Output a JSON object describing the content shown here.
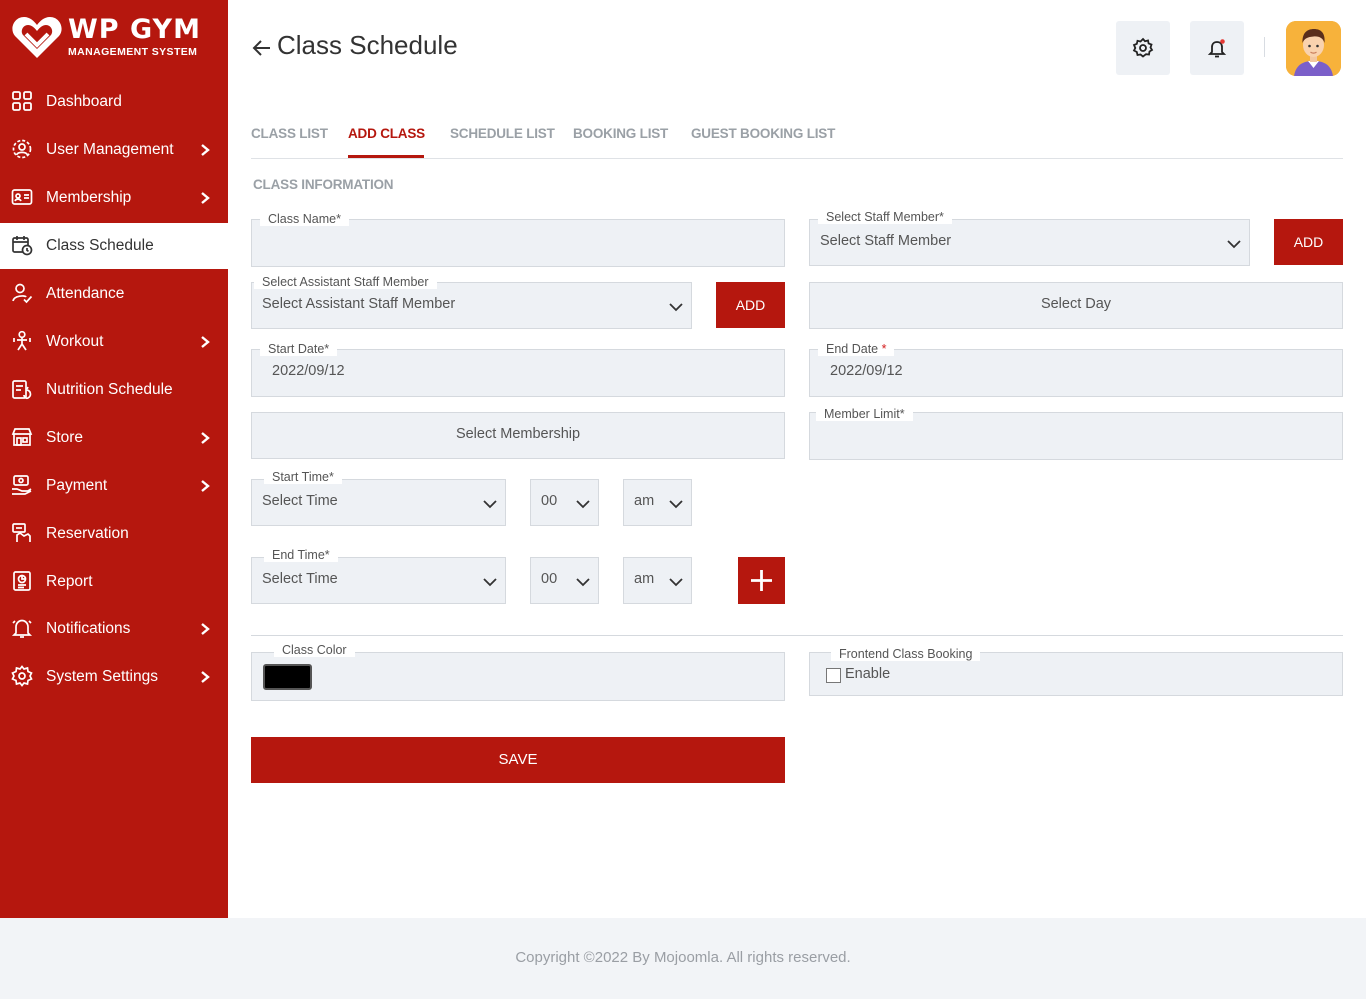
{
  "brand": {
    "name": "WP GYM",
    "subtitle": "MANAGEMENT SYSTEM"
  },
  "sidebar": {
    "items": [
      {
        "label": "Dashboard",
        "icon": "dashboard-icon",
        "has_submenu": false,
        "active": false
      },
      {
        "label": "User Management",
        "icon": "user-management-icon",
        "has_submenu": true,
        "active": false
      },
      {
        "label": "Membership",
        "icon": "membership-icon",
        "has_submenu": true,
        "active": false
      },
      {
        "label": "Class Schedule",
        "icon": "class-schedule-icon",
        "has_submenu": false,
        "active": true
      },
      {
        "label": "Attendance",
        "icon": "attendance-icon",
        "has_submenu": false,
        "active": false
      },
      {
        "label": "Workout",
        "icon": "workout-icon",
        "has_submenu": true,
        "active": false
      },
      {
        "label": "Nutrition Schedule",
        "icon": "nutrition-icon",
        "has_submenu": false,
        "active": false
      },
      {
        "label": "Store",
        "icon": "store-icon",
        "has_submenu": true,
        "active": false
      },
      {
        "label": "Payment",
        "icon": "payment-icon",
        "has_submenu": true,
        "active": false
      },
      {
        "label": "Reservation",
        "icon": "reservation-icon",
        "has_submenu": false,
        "active": false
      },
      {
        "label": "Report",
        "icon": "report-icon",
        "has_submenu": false,
        "active": false
      },
      {
        "label": "Notifications",
        "icon": "notifications-icon",
        "has_submenu": true,
        "active": false
      },
      {
        "label": "System Settings",
        "icon": "system-settings-icon",
        "has_submenu": true,
        "active": false
      }
    ]
  },
  "header": {
    "title": "Class Schedule"
  },
  "tabs": [
    {
      "label": "CLASS LIST",
      "active": false
    },
    {
      "label": "ADD CLASS",
      "active": true
    },
    {
      "label": "SCHEDULE LIST",
      "active": false
    },
    {
      "label": "BOOKING LIST",
      "active": false
    },
    {
      "label": "GUEST BOOKING LIST",
      "active": false
    }
  ],
  "form": {
    "section_title": "CLASS INFORMATION",
    "class_name": {
      "label": "Class Name*",
      "value": ""
    },
    "staff_member": {
      "label": "Select Staff Member*",
      "value": "Select Staff Member",
      "add_label": "ADD"
    },
    "assistant_staff": {
      "label": "Select Assistant Staff Member",
      "value": "Select Assistant Staff Member",
      "add_label": "ADD"
    },
    "select_day": {
      "label": "Select Day"
    },
    "start_date": {
      "label": "Start Date*",
      "value": "2022/09/12"
    },
    "end_date": {
      "label": "End Date",
      "required_mark": "*",
      "value": "2022/09/12"
    },
    "membership": {
      "label": "Select Membership"
    },
    "member_limit": {
      "label": "Member Limit*",
      "value": ""
    },
    "start_time": {
      "label": "Start Time*",
      "hour": "Select Time",
      "minute": "00",
      "ampm": "am"
    },
    "end_time": {
      "label": "End Time*",
      "hour": "Select Time",
      "minute": "00",
      "ampm": "am"
    },
    "class_color": {
      "label": "Class Color",
      "value": "#000000"
    },
    "frontend_booking": {
      "label": "Frontend Class Booking",
      "checkbox_label": "Enable",
      "checked": false
    },
    "save_label": "SAVE"
  },
  "footer": {
    "text": "Copyright ©2022 By Mojoomla. All rights reserved."
  },
  "colors": {
    "primary": "#b5170e",
    "field_bg": "#eef1f5",
    "footer_bg": "#f2f4f7"
  }
}
